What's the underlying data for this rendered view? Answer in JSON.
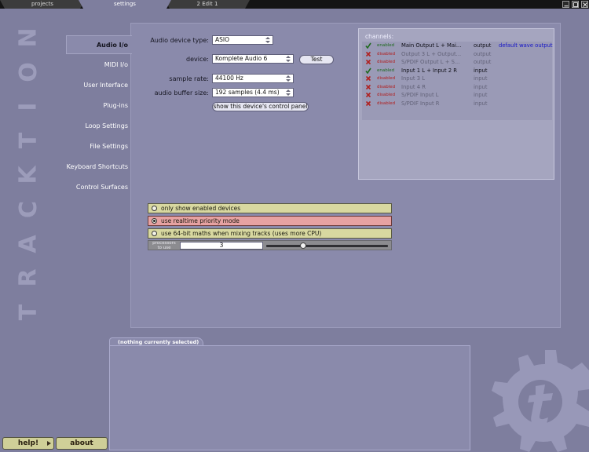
{
  "tabs": [
    {
      "label": "projects",
      "active": false
    },
    {
      "label": "settings",
      "active": true
    },
    {
      "label": "2 Edit 1",
      "active": false
    }
  ],
  "logo_text": "TRACKTION",
  "nav": {
    "items": [
      {
        "label": "Audio I/o",
        "active": true
      },
      {
        "label": "MIDI I/o",
        "active": false
      },
      {
        "label": "User Interface",
        "active": false
      },
      {
        "label": "Plug-ins",
        "active": false
      },
      {
        "label": "Loop Settings",
        "active": false
      },
      {
        "label": "File Settings",
        "active": false
      },
      {
        "label": "Keyboard Shortcuts",
        "active": false
      },
      {
        "label": "Control Surfaces",
        "active": false
      }
    ]
  },
  "audio": {
    "device_type_label": "Audio device type:",
    "device_type_value": "ASIO",
    "device_label": "device:",
    "device_value": "Komplete Audio 6",
    "test_label": "Test",
    "sample_rate_label": "sample rate:",
    "sample_rate_value": "44100 Hz",
    "buffer_label": "audio buffer size:",
    "buffer_value": "192 samples (4.4 ms)",
    "control_panel_label": "show this device's control panel"
  },
  "channels": {
    "title": "channels:",
    "rows": [
      {
        "status": "enabled",
        "name": "Main Output L + Mai...",
        "type": "output",
        "default": "default wave output"
      },
      {
        "status": "disabled",
        "name": "Output 3 L + Output...",
        "type": "output",
        "default": ""
      },
      {
        "status": "disabled",
        "name": "S/PDIF Output L + S...",
        "type": "output",
        "default": ""
      },
      {
        "status": "enabled",
        "name": "Input 1 L + Input 2 R",
        "type": "input",
        "default": ""
      },
      {
        "status": "disabled",
        "name": "Input 3 L",
        "type": "input",
        "default": ""
      },
      {
        "status": "disabled",
        "name": "Input 4 R",
        "type": "input",
        "default": ""
      },
      {
        "status": "disabled",
        "name": "S/PDIF Input L",
        "type": "input",
        "default": ""
      },
      {
        "status": "disabled",
        "name": "S/PDIF Input R",
        "type": "input",
        "default": ""
      }
    ]
  },
  "options": {
    "only_enabled_label": "only show enabled devices",
    "only_enabled_on": false,
    "realtime_label": "use realtime priority mode",
    "realtime_on": true,
    "bit64_label": "use 64-bit maths when mixing tracks (uses more CPU)",
    "bit64_on": false
  },
  "processors": {
    "label": "processors to use",
    "value": "3",
    "slider_fraction": 0.3
  },
  "properties": {
    "tab_label": "(nothing currently selected)"
  },
  "buttons": {
    "help": "help!",
    "about": "about"
  },
  "colors": {
    "background": "#7e7e9e",
    "panel": "#8a8aab",
    "option_yellow": "#d8d8a0",
    "option_red": "#e6a2a2",
    "enabled_green": "#1f6a1f",
    "disabled_red": "#b02020",
    "link_blue": "#1414c8"
  }
}
